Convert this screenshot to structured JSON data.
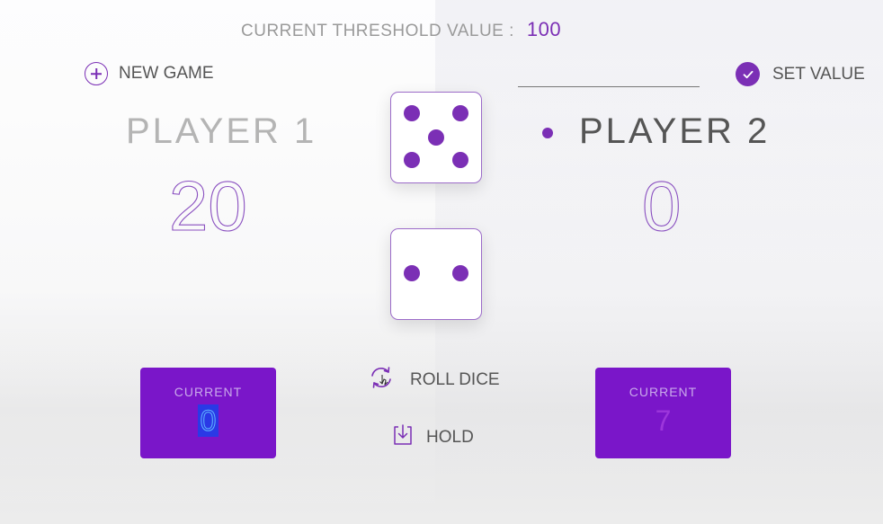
{
  "header": {
    "threshold_label": "CURRENT THRESHOLD VALUE :",
    "threshold_value": "100"
  },
  "controls": {
    "new_game_label": "NEW GAME",
    "set_value_label": "SET VALUE",
    "threshold_input_value": "",
    "roll_dice_label": "ROLL DICE",
    "hold_label": "HOLD"
  },
  "players": [
    {
      "name": "PLAYER 1",
      "score": "20",
      "current_label": "CURRENT",
      "current_value": "0",
      "active": false
    },
    {
      "name": "PLAYER 2",
      "score": "0",
      "current_label": "CURRENT",
      "current_value": "7",
      "active": true
    }
  ],
  "dice": [
    {
      "value": 5
    },
    {
      "value": 2
    }
  ],
  "colors": {
    "accent": "#7b2fb5",
    "current_box": "#7a16c9"
  },
  "icons": {
    "new_game": "plus-circle-icon",
    "set_value": "check-circle-icon",
    "roll_dice": "refresh-icon",
    "hold": "download-icon",
    "active_player": "dot-icon"
  }
}
